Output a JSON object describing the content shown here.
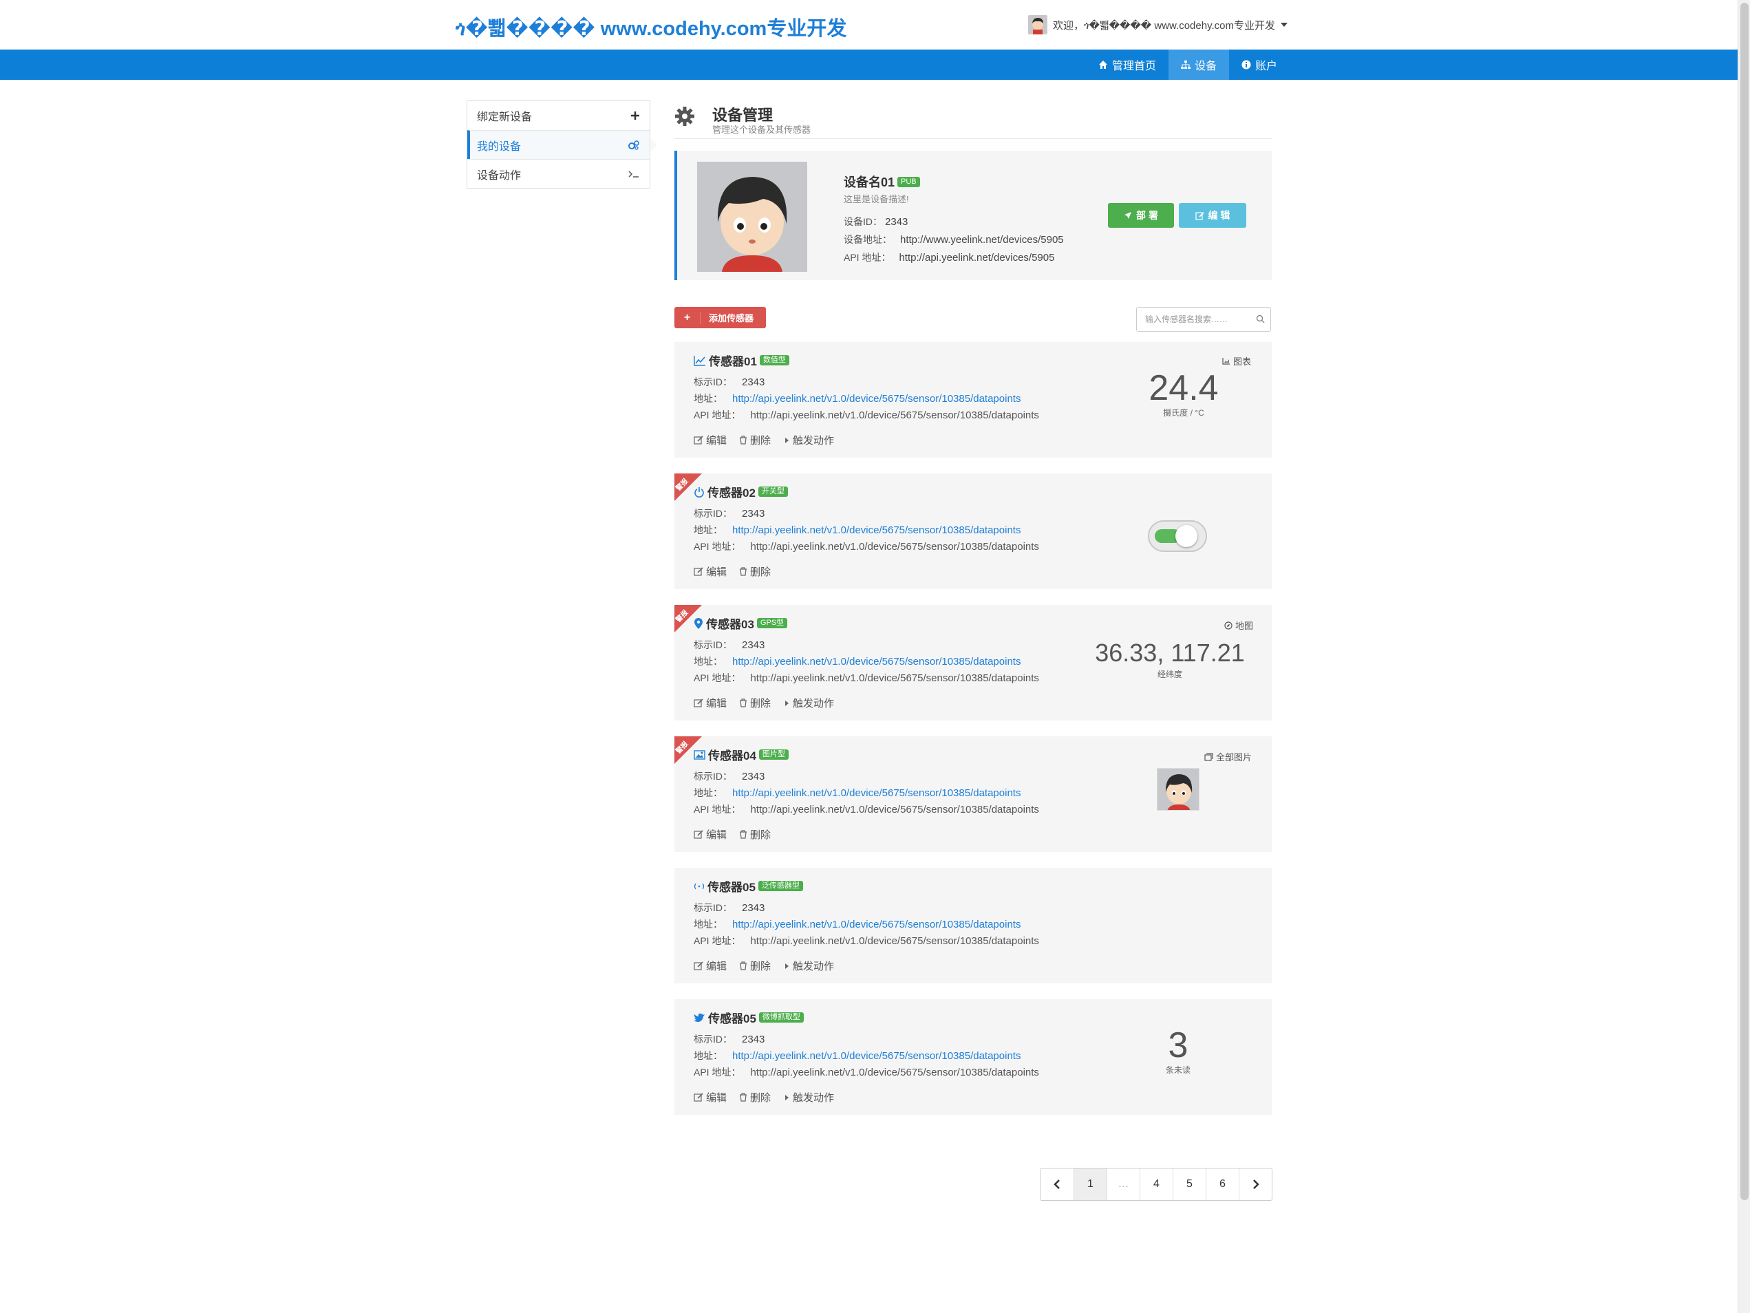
{
  "header": {
    "brand": "ጎ�뾃���� www.codehy.com专业开发",
    "user_greeting": "欢迎，ጎ�뾃���� www.codehy.com专业开发",
    "nav": [
      {
        "label": "管理首页",
        "icon": "home-icon"
      },
      {
        "label": "设备",
        "icon": "sitemap-icon"
      },
      {
        "label": "账户",
        "icon": "info-icon"
      }
    ]
  },
  "sidebar": {
    "items": [
      {
        "label": "绑定新设备",
        "icon": "plus-icon"
      },
      {
        "label": "我的设备",
        "icon": "cogs-icon"
      },
      {
        "label": "设备动作",
        "icon": "terminal-icon"
      }
    ]
  },
  "page": {
    "title": "设备管理",
    "subtitle": "管理这个设备及其传感器"
  },
  "device": {
    "name": "设备名01",
    "badge": "PUB",
    "description": "这里是设备描述!",
    "id_label": "设备ID：",
    "id": "2343",
    "url_label": "设备地址：",
    "url": "http://www.yeelink.net/devices/5905",
    "api_label": "API 地址：",
    "api": "http://api.yeelink.net/devices/5905",
    "deploy_label": "部 署",
    "edit_label": "编 辑"
  },
  "toolbar": {
    "add_label": "添加传感器",
    "search_placeholder": "输入传感器名搜索……"
  },
  "labels": {
    "sensor_id": "标示ID：",
    "address": "地址：",
    "api_address": "API 地址：",
    "edit": "编辑",
    "delete": "删除",
    "trigger": "触发动作",
    "corner_tag": "警报"
  },
  "sensors": [
    {
      "name": "传感器01",
      "type": "数值型",
      "id": "2343",
      "address": "http://api.yeelink.net/v1.0/device/5675/sensor/10385/datapoints",
      "api": "http://api.yeelink.net/v1.0/device/5675/sensor/10385/datapoints",
      "right_link": "图表",
      "value": "24.4",
      "unit": "摄氏度 / °C"
    },
    {
      "name": "传感器02",
      "type": "开关型",
      "id": "2343",
      "address": "http://api.yeelink.net/v1.0/device/5675/sensor/10385/datapoints",
      "api": "http://api.yeelink.net/v1.0/device/5675/sensor/10385/datapoints",
      "switch_on": true
    },
    {
      "name": "传感器03",
      "type": "GPS型",
      "id": "2343",
      "address": "http://api.yeelink.net/v1.0/device/5675/sensor/10385/datapoints",
      "api": "http://api.yeelink.net/v1.0/device/5675/sensor/10385/datapoints",
      "right_link": "地图",
      "value": "36.33, 117.21",
      "unit": "经纬度"
    },
    {
      "name": "传感器04",
      "type": "图片型",
      "id": "2343",
      "address": "http://api.yeelink.net/v1.0/device/5675/sensor/10385/datapoints",
      "api": "http://api.yeelink.net/v1.0/device/5675/sensor/10385/datapoints",
      "right_link": "全部图片"
    },
    {
      "name": "传感器05",
      "type": "泛传感器型",
      "id": "2343",
      "address": "http://api.yeelink.net/v1.0/device/5675/sensor/10385/datapoints",
      "api": "http://api.yeelink.net/v1.0/device/5675/sensor/10385/datapoints"
    },
    {
      "name": "传感器05",
      "type": "微博抓取型",
      "id": "2343",
      "address": "http://api.yeelink.net/v1.0/device/5675/sensor/10385/datapoints",
      "api": "http://api.yeelink.net/v1.0/device/5675/sensor/10385/datapoints",
      "value": "3",
      "unit": "条未读"
    }
  ],
  "pagination": {
    "pages": [
      "1",
      "…",
      "4",
      "5",
      "6"
    ],
    "current": "1"
  },
  "colors": {
    "primary": "#0d7fd6",
    "success": "#4cae4c",
    "info": "#5bc0de",
    "danger": "#d9534f"
  }
}
